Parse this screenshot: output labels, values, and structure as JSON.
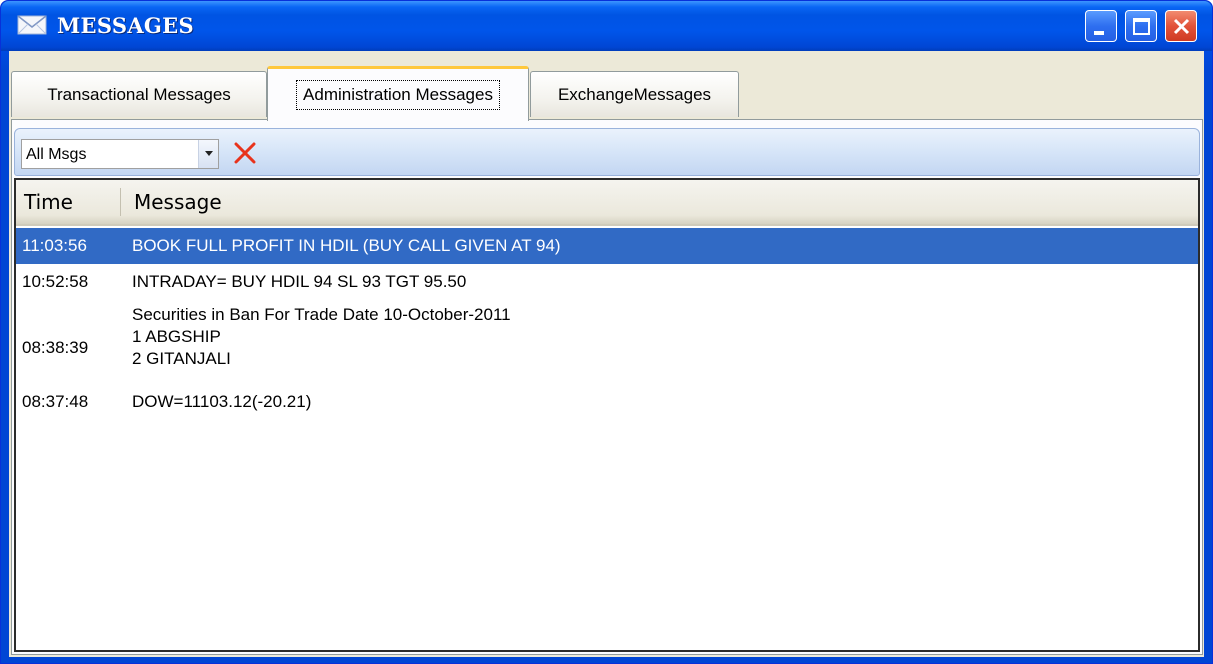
{
  "window": {
    "title": "MESSAGES",
    "icon": "envelope-icon"
  },
  "tabs": [
    {
      "label": "Transactional Messages",
      "selected": false
    },
    {
      "label": "Administration Messages",
      "selected": true
    },
    {
      "label": "ExchangeMessages",
      "selected": false
    }
  ],
  "toolbar": {
    "filter_value": "All Msgs",
    "clear_icon": "red-x-icon"
  },
  "grid": {
    "columns": [
      "Time",
      "Message"
    ],
    "rows": [
      {
        "time": "11:03:56",
        "message": "BOOK FULL PROFIT IN HDIL (BUY CALL GIVEN AT 94)",
        "selected": true
      },
      {
        "time": "10:52:58",
        "message": "INTRADAY= BUY HDIL 94 SL 93 TGT 95.50",
        "selected": false
      },
      {
        "time": "08:38:39",
        "message": "Securities in Ban For Trade Date 10-October-2011\n1 ABGSHIP\n2 GITANJALI",
        "selected": false
      },
      {
        "time": "08:37:48",
        "message": "DOW=11103.12(-20.21)",
        "selected": false
      }
    ]
  },
  "colors": {
    "title_bar": "#0054e3",
    "selection": "#316ac5",
    "active_tab_highlight": "#ffc83c",
    "clear_icon": "#e8331c"
  }
}
